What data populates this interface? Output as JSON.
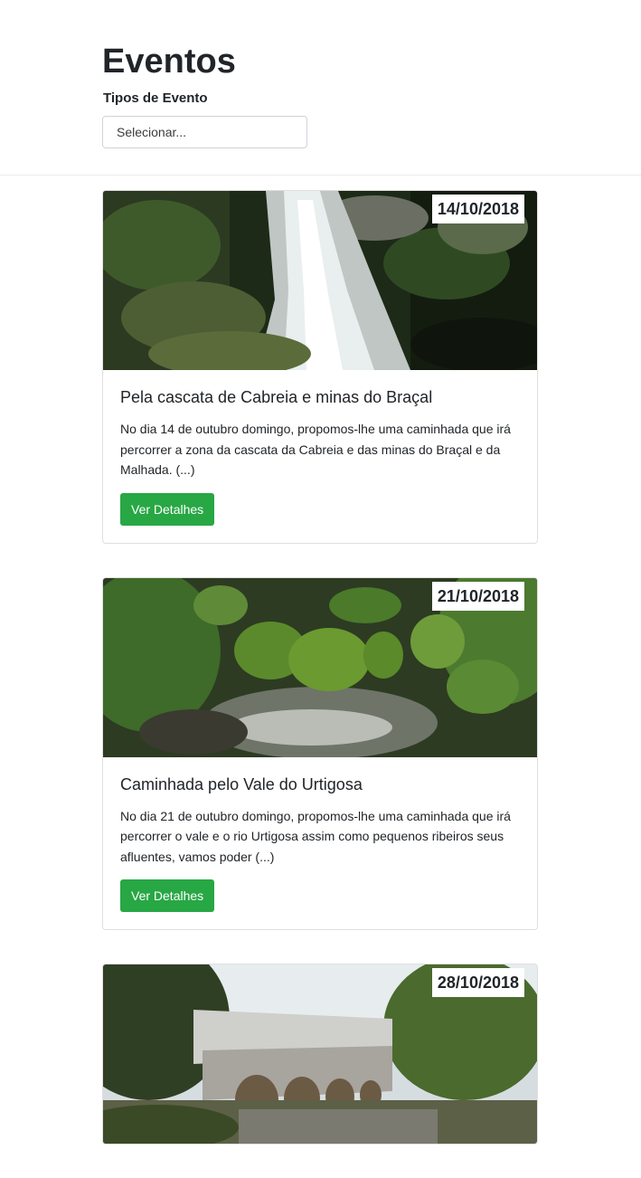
{
  "page": {
    "title": "Eventos"
  },
  "filter": {
    "label": "Tipos de Evento",
    "placeholder": "Selecionar..."
  },
  "events": [
    {
      "date": "14/10/2018",
      "title": "Pela cascata de Cabreia e minas do Braçal",
      "description": "No dia 14 de outubro domingo, propomos-lhe uma caminhada que irá percorrer a zona da cascata da Cabreia e das minas do Braçal e da Malhada. (...)",
      "button_label": "Ver Detalhes",
      "image": "waterfall-photo"
    },
    {
      "date": "21/10/2018",
      "title": "Caminhada pelo Vale do Urtigosa",
      "description": "No dia 21 de outubro domingo, propomos-lhe uma caminhada que irá percorrer o vale e o rio Urtigosa assim como pequenos ribeiros seus afluentes, vamos poder (...)",
      "button_label": "Ver Detalhes",
      "image": "mossy-stream-photo"
    },
    {
      "date": "28/10/2018",
      "title": "",
      "description": "",
      "button_label": "",
      "image": "stone-bridge-photo"
    }
  ],
  "colors": {
    "button": "#28a745",
    "text": "#212529",
    "border": "#dfdfdf"
  }
}
